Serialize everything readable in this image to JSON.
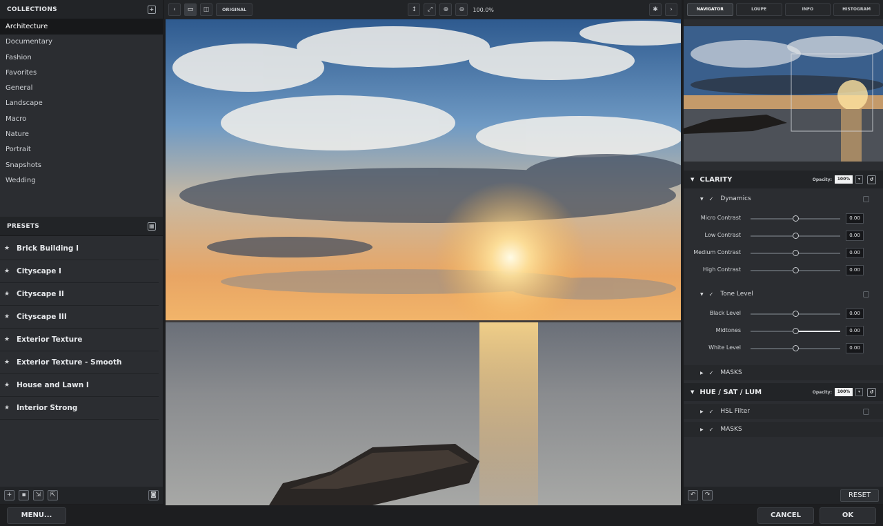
{
  "collections": {
    "title": "COLLECTIONS",
    "items": [
      "Architecture",
      "Documentary",
      "Fashion",
      "Favorites",
      "General",
      "Landscape",
      "Macro",
      "Nature",
      "Portrait",
      "Snapshots",
      "Wedding"
    ]
  },
  "presets": {
    "title": "PRESETS",
    "items": [
      "Brick Building I",
      "Cityscape I",
      "Cityscape II",
      "Cityscape III",
      "Exterior Texture",
      "Exterior Texture - Smooth",
      "House and Lawn I",
      "Interior Strong"
    ]
  },
  "toolbar": {
    "original_label": "ORIGINAL",
    "zoom": "100.0%"
  },
  "right_tabs": [
    "NAVIGATOR",
    "LOUPE",
    "INFO",
    "HISTOGRAM"
  ],
  "clarity": {
    "title": "CLARITY",
    "opacity_label": "Opacity:",
    "opacity_value": "100%",
    "dynamics_label": "Dynamics",
    "dynamics_sliders": [
      {
        "label": "Micro Contrast",
        "value": "0.00",
        "level": 0.5
      },
      {
        "label": "Low Contrast",
        "value": "0.00",
        "level": 0.5
      },
      {
        "label": "Medium Contrast",
        "value": "0.00",
        "level": 0.5
      },
      {
        "label": "High Contrast",
        "value": "0.00",
        "level": 0.5
      }
    ],
    "tone_label": "Tone Level",
    "tone_sliders": [
      {
        "label": "Black Level",
        "value": "0.00",
        "level": 0.5
      },
      {
        "label": "Midtones",
        "value": "0.00",
        "level": 0.5
      },
      {
        "label": "White Level",
        "value": "0.00",
        "level": 0.5
      }
    ],
    "masks_label": "MASKS"
  },
  "hsl": {
    "title": "HUE / SAT / LUM",
    "opacity_label": "Opacity:",
    "opacity_value": "100%",
    "filter_label": "HSL Filter",
    "masks_label": "MASKS"
  },
  "right_footer": {
    "reset_label": "RESET"
  },
  "bottom": {
    "menu_label": "MENU...",
    "cancel_label": "CANCEL",
    "ok_label": "OK"
  }
}
